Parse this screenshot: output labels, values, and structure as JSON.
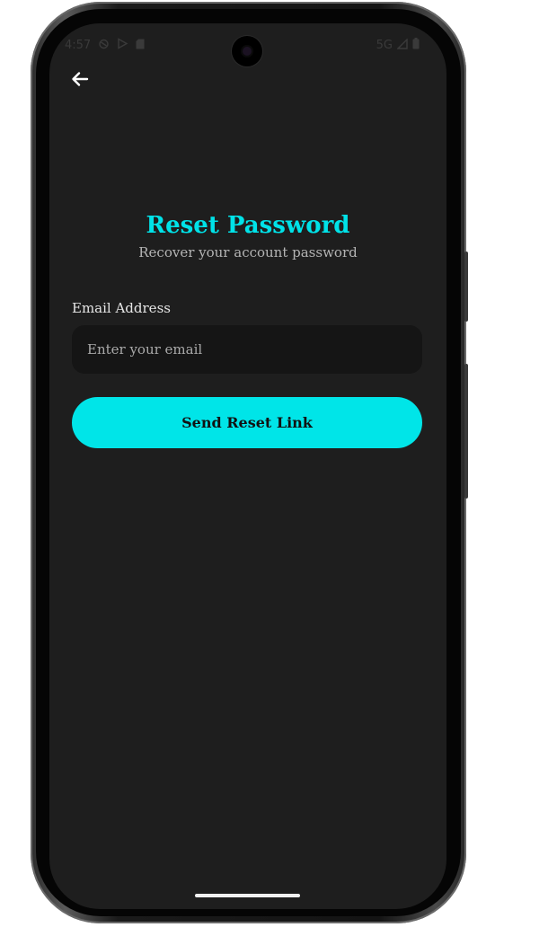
{
  "status_bar": {
    "time": "4:57",
    "network": "5G",
    "left_icons": [
      "alarm-icon",
      "play-store-icon",
      "sd-card-icon"
    ],
    "right_icons": [
      "signal-icon",
      "battery-icon"
    ]
  },
  "header": {
    "back_icon": "arrow-left-icon"
  },
  "main": {
    "title": "Reset Password",
    "subtitle": "Recover your account password",
    "email_label": "Email Address",
    "email_placeholder": "Enter your email",
    "email_value": "",
    "submit_label": "Send Reset Link"
  },
  "colors": {
    "accent": "#00e5e8",
    "background": "#1e1e1e",
    "input_background": "#151515"
  }
}
